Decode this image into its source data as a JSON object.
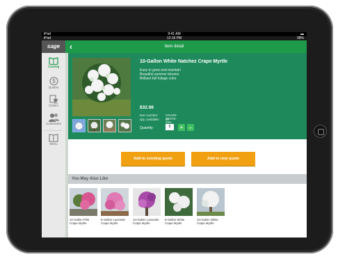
{
  "status_bar": {
    "device_top": "iPad",
    "time_top": "9:41 AM",
    "device_bottom": "iPad",
    "time_bottom": "12:16 PM",
    "battery": "98%"
  },
  "topbar": {
    "logo": "sage",
    "title": "Item detail",
    "accent": "#1f9a4a"
  },
  "sidebar": {
    "items": [
      {
        "label": "Catalog",
        "icon": "book-icon",
        "active": true
      },
      {
        "label": "Quotes",
        "icon": "dollar-icon",
        "active": false
      },
      {
        "label": "Orders",
        "icon": "cart-icon",
        "active": false
      },
      {
        "label": "Customers",
        "icon": "people-icon",
        "active": false
      },
      {
        "label": "Menu",
        "icon": "menu-book-icon",
        "active": false
      }
    ]
  },
  "product": {
    "name": "10-Gallon White Natchez Crape Myrtle",
    "features": [
      "Easy to grow and maintain",
      "Beautiful summer blooms",
      "Brilliant fall foliage color"
    ],
    "price": "$32.98",
    "item_number_label": "Item number:",
    "item_number": "CRAPE-WHITE-10G",
    "qty_available_label": "Qty. available:",
    "qty_available": "37",
    "quantity_label": "Quantity:",
    "quantity_value": "0",
    "plus": "+",
    "minus": "–"
  },
  "actions": {
    "add_existing": "Add to existing quote",
    "add_new": "Add to new quote",
    "button_color": "#f0a010"
  },
  "recommendations": {
    "title": "You May Also Like",
    "items": [
      {
        "name": "10-Gallon Pink Crape Myrtle",
        "color": "#e05a9a"
      },
      {
        "name": "5-Gallon Lavender Crape Myrtle",
        "color": "#d96aa8"
      },
      {
        "name": "10-Gallon Lavender Crape Myrtle",
        "color": "#b04aa8"
      },
      {
        "name": "5-Gallon White Crape Myrtle",
        "color": "#f3f3f3"
      },
      {
        "name": "10-Gallon White Crape Myrtle",
        "color": "#f3f3f3"
      }
    ]
  }
}
